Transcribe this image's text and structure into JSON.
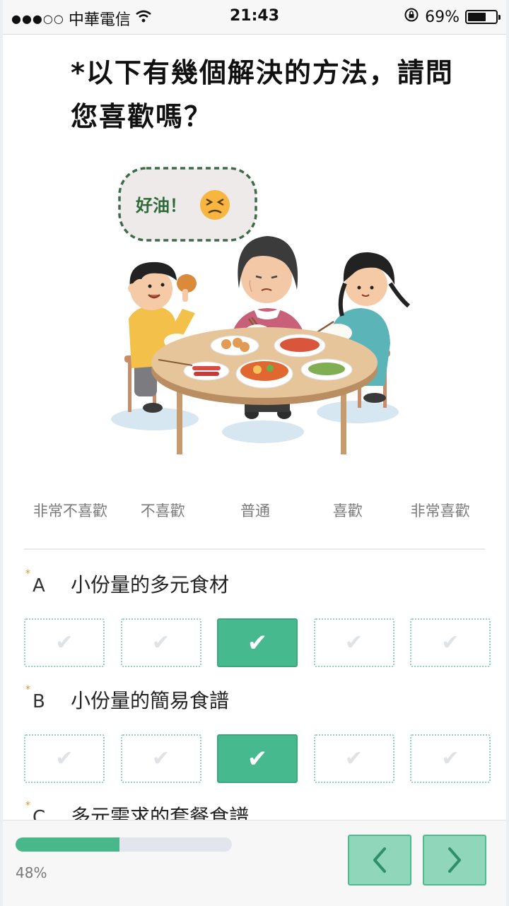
{
  "status_bar": {
    "signal": "●●●○○",
    "carrier": "中華電信",
    "time": "21:43",
    "battery_percent": "69%",
    "battery_level": 0.69
  },
  "question": {
    "title": "*以下有幾個解決的方法，請問您喜歡嗎？",
    "bubble_text": "好油！"
  },
  "scale_labels": [
    "非常不喜歡",
    "不喜歡",
    "普通",
    "喜歡",
    "非常喜歡"
  ],
  "items": [
    {
      "required": "*",
      "letter": "A",
      "text": "小份量的多元食材",
      "selected_index": 2
    },
    {
      "required": "*",
      "letter": "B",
      "text": "小份量的簡易食譜",
      "selected_index": 2
    },
    {
      "required": "*",
      "letter": "C",
      "text": "多元需求的套餐食譜",
      "selected_index": null
    }
  ],
  "checkmark": "✔",
  "progress": {
    "percent_label": "48%",
    "fraction": 0.48
  },
  "nav": {
    "prev_icon": "chevron-left-icon",
    "next_icon": "chevron-right-icon"
  },
  "colors": {
    "accent": "#47b98e",
    "button_bg": "#8fd6bb",
    "required_star": "#e8922a"
  }
}
